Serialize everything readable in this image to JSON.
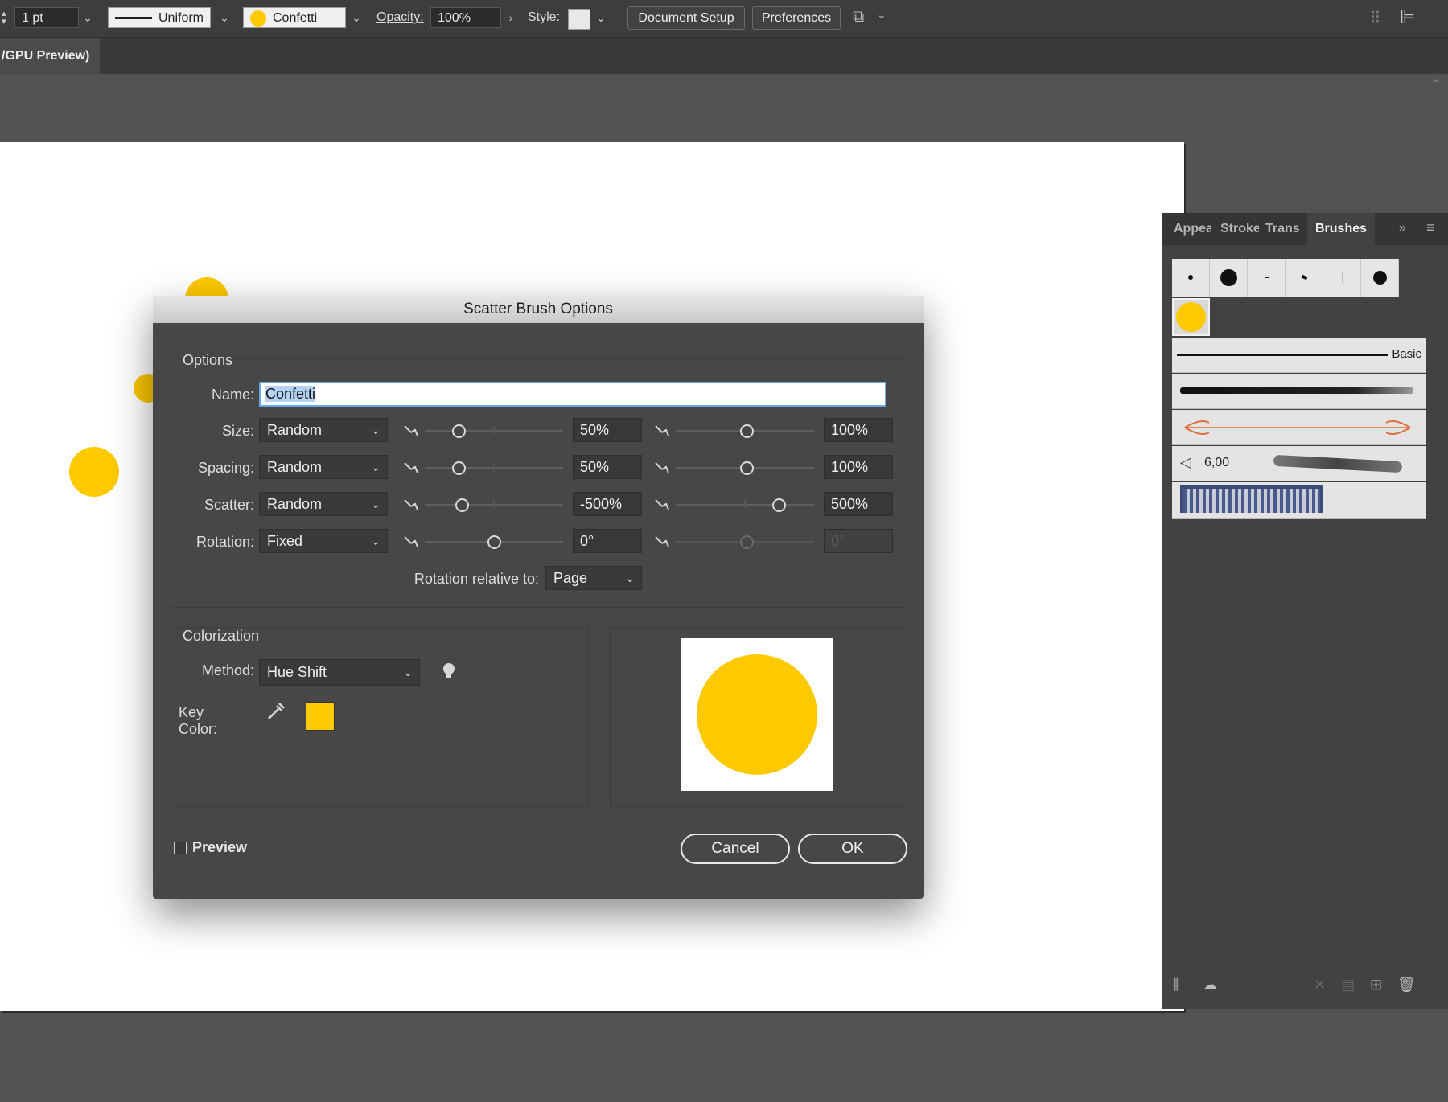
{
  "control_bar": {
    "stroke_weight": "1 pt",
    "profile": "Uniform",
    "brush_name": "Confetti",
    "opacity_label": "Opacity:",
    "opacity_value": "100%",
    "style_label": "Style:",
    "document_setup": "Document Setup",
    "preferences": "Preferences"
  },
  "doc_tab": {
    "title": "/GPU Preview)"
  },
  "dialog": {
    "title": "Scatter Brush Options",
    "options_group": "Options",
    "name_label": "Name:",
    "name_value": "Confetti",
    "rows": [
      {
        "label": "Size:",
        "mode": "Random",
        "min": "50%",
        "max": "100%"
      },
      {
        "label": "Spacing:",
        "mode": "Random",
        "min": "50%",
        "max": "100%"
      },
      {
        "label": "Scatter:",
        "mode": "Random",
        "min": "-500%",
        "max": "500%"
      },
      {
        "label": "Rotation:",
        "mode": "Fixed",
        "min": "0°",
        "max": "0°"
      }
    ],
    "rotation_relative_label": "Rotation relative to:",
    "rotation_relative_value": "Page",
    "colorization_group": "Colorization",
    "method_label": "Method:",
    "method_value": "Hue Shift",
    "key_color_label": "Key Color:",
    "key_color": "#fdc900",
    "preview_label": "Preview",
    "cancel": "Cancel",
    "ok": "OK"
  },
  "panel": {
    "tabs": [
      "Appea",
      "Stroke",
      "Trans",
      "Brushes"
    ],
    "active_tab": "Brushes",
    "basic_label": "Basic",
    "bristle_value": "6,00"
  },
  "colors": {
    "accent": "#fdc900",
    "dialog_bg": "#474747",
    "app_bg": "#535353"
  }
}
